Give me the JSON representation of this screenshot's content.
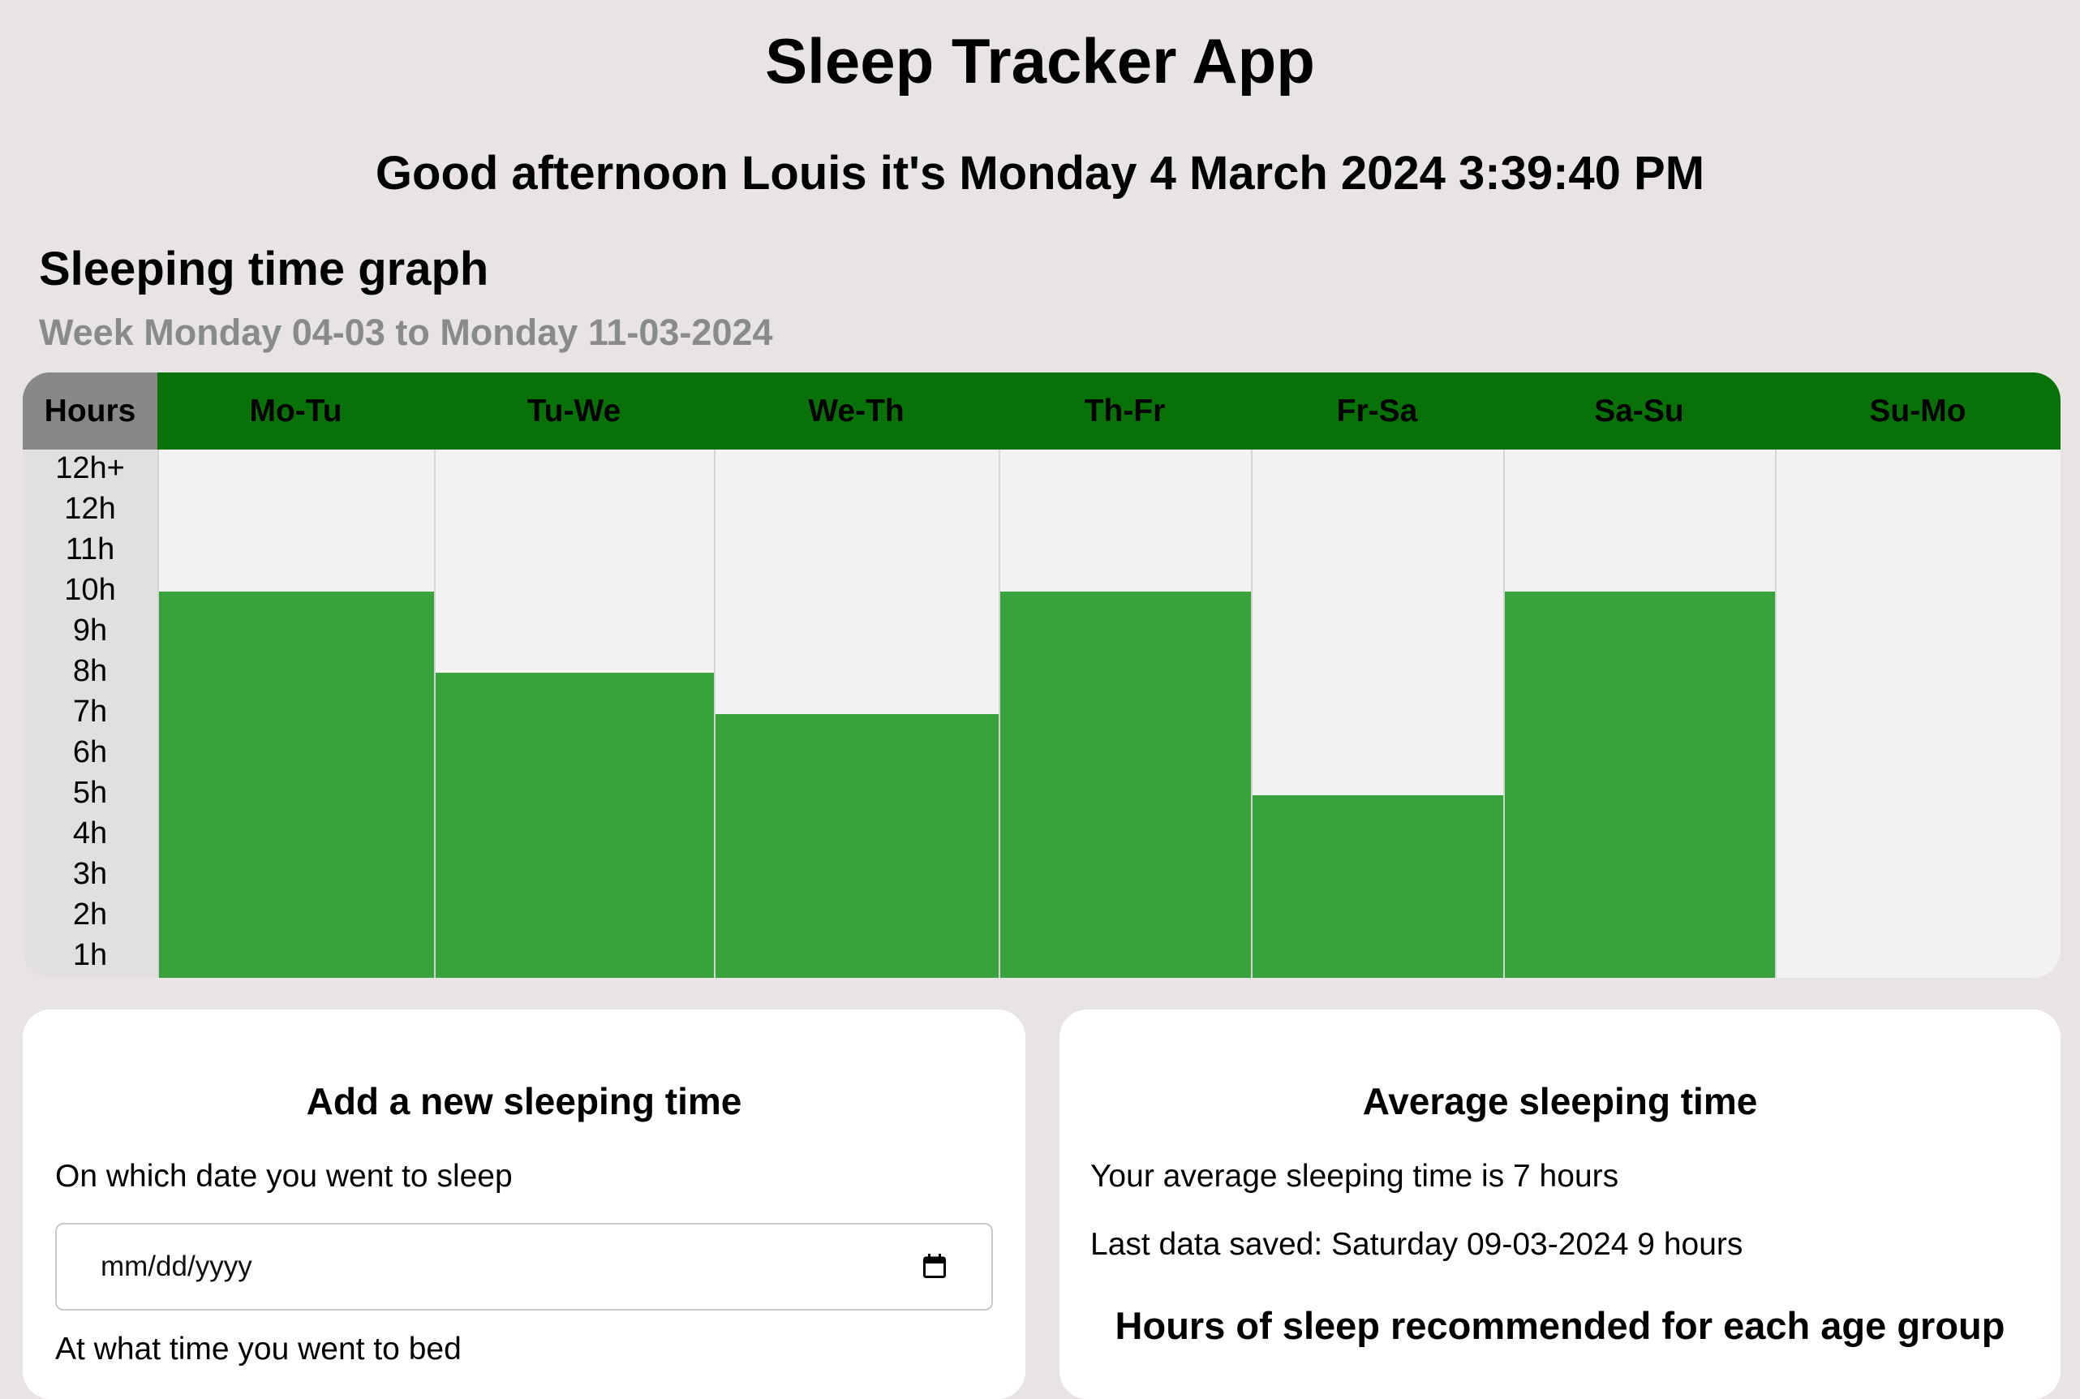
{
  "header": {
    "title": "Sleep Tracker App",
    "greeting": "Good afternoon Louis it's Monday 4 March 2024 3:39:40 PM"
  },
  "graph_section": {
    "title": "Sleeping time graph",
    "week": "Week Monday 04-03 to Monday 11-03-2024"
  },
  "chart_data": {
    "type": "bar",
    "categories": [
      "Mo-Tu",
      "Tu-We",
      "We-Th",
      "Th-Fr",
      "Fr-Sa",
      "Sa-Su",
      "Su-Mo"
    ],
    "values": [
      9,
      7,
      6,
      9,
      4,
      9,
      null
    ],
    "y_header": "Hours",
    "y_tick_labels": [
      "12h+",
      "12h",
      "11h",
      "10h",
      "9h",
      "8h",
      "7h",
      "6h",
      "5h",
      "4h",
      "3h",
      "2h",
      "1h"
    ],
    "ylim": [
      0,
      13
    ],
    "colors": {
      "header": "#087208",
      "bar": "#38a33a",
      "axis_header": "#888888",
      "background": "#f2f2f2"
    }
  },
  "add_card": {
    "title": "Add a new sleeping time",
    "date_label": "On which date you went to sleep",
    "date_placeholder": "mm/dd/yyyy",
    "bedtime_label": "At what time you went to bed"
  },
  "average_card": {
    "title": "Average sleeping time",
    "average_text": "Your average sleeping time is 7 hours",
    "last_saved": "Last data saved: Saturday 09-03-2024 9 hours",
    "age_group_title": "Hours of sleep recommended for each age group"
  },
  "icons": {
    "date_picker": "calendar-icon"
  }
}
